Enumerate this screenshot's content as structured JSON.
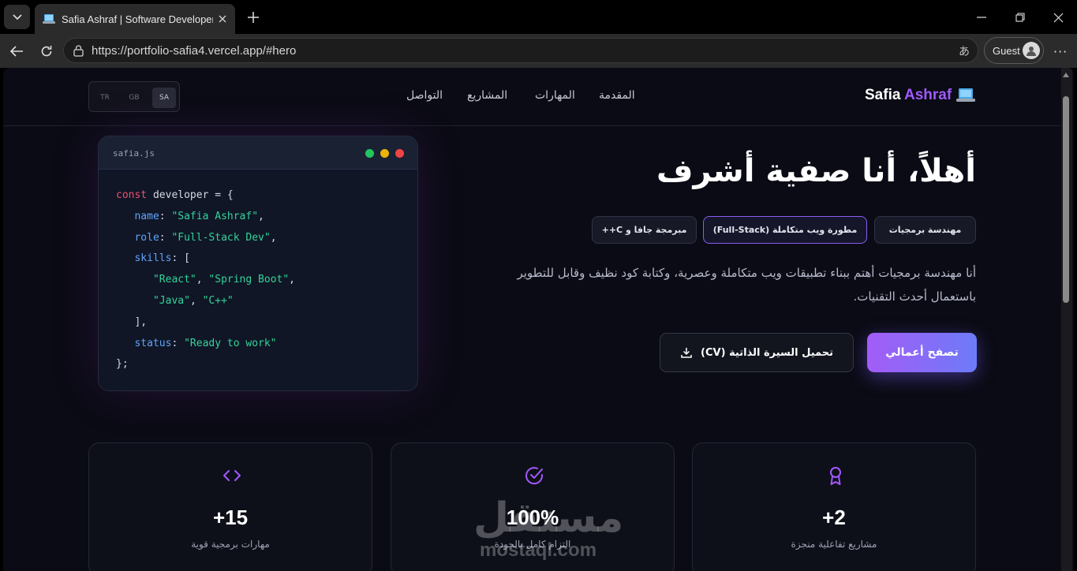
{
  "browser": {
    "tab_title": "Safia Ashraf | Software Developer",
    "url_host": "https://portfolio-safia4.vercel.app",
    "url_path": "/#hero",
    "profile_label": "Guest",
    "menu_label": "···"
  },
  "nav": {
    "brand_first": "Safia ",
    "brand_accent": "Ashraf",
    "links": [
      "المقدمة",
      "المهارات",
      "المشاريع",
      "التواصل"
    ],
    "languages": [
      "TR",
      "GB",
      "SA"
    ],
    "active_language": "SA"
  },
  "code_card": {
    "filename": "safia.js",
    "keyword": "const",
    "var_name": " developer = {",
    "name_key": "name",
    "name_val": "\"Safia Ashraf\"",
    "role_key": "role",
    "role_val": "\"Full-Stack Dev\"",
    "skills_key": "skills",
    "skill_1": "\"React\"",
    "skill_2": "\"Spring Boot\"",
    "skill_3": "\"Java\"",
    "skill_4": "\"C++\"",
    "status_key": "status",
    "status_val": "\"Ready to work\"",
    "close_brace": "};"
  },
  "hero": {
    "title": "أهلاً، أنا صفية أشرف",
    "chips": [
      "مهندسة برمجيات",
      "مطورة ويب متكاملة (Full-Stack)",
      "مبرمجة جافا و C++"
    ],
    "description": "أنا مهندسة برمجيات أهتم ببناء تطبيقات ويب متكاملة وعصرية، وكتابة كود نظيف وقابل للتطوير باستعمال أحدث التقنيات.",
    "primary_button": "تصفح أعمالي",
    "secondary_button": "تحميل السيرة الذاتية (CV)"
  },
  "stats": [
    {
      "value": "+15",
      "label": "مهارات برمجية قوية",
      "icon": "code-icon"
    },
    {
      "value": "100%",
      "label": "التزام كامل بالجودة",
      "icon": "check-circle-icon"
    },
    {
      "value": "+2",
      "label": "مشاريع تفاعلية منجزة",
      "icon": "award-icon"
    }
  ],
  "watermark": {
    "arabic": "مستقل",
    "latin": "mostaql.com"
  },
  "colors": {
    "accent": "#a259ff",
    "gradient_start": "#a35cf7",
    "gradient_end": "#6d7bf7",
    "background": "#0a0b14"
  }
}
